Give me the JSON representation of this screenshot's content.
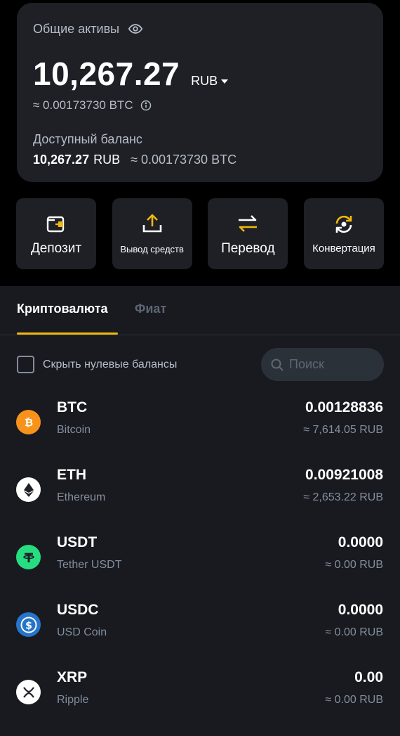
{
  "assets": {
    "title": "Общие активы",
    "total": "10,267.27",
    "currency": "RUB",
    "btc_equivalent": "≈ 0.00173730 BTC",
    "available_label": "Доступный баланс",
    "available_amount": "10,267.27",
    "available_currency": "RUB",
    "available_btc": "≈ 0.00173730 BTC"
  },
  "actions": [
    {
      "label": "Депозит",
      "icon": "deposit-wallet-icon"
    },
    {
      "label": "Вывод средств",
      "icon": "withdraw-upload-icon"
    },
    {
      "label": "Перевод",
      "icon": "transfer-arrows-icon"
    },
    {
      "label": "Конвертация",
      "icon": "convert-cycle-icon"
    }
  ],
  "tabs": {
    "crypto": "Криптовалюта",
    "fiat": "Фиат"
  },
  "filter": {
    "hide_zero_label": "Скрыть нулевые балансы",
    "search_placeholder": "Поиск"
  },
  "coins": [
    {
      "symbol": "BTC",
      "name": "Bitcoin",
      "amount": "0.00128836",
      "fiat": "≈ 7,614.05 RUB",
      "color": "#f7931a",
      "icon": "bitcoin-icon"
    },
    {
      "symbol": "ETH",
      "name": "Ethereum",
      "amount": "0.00921008",
      "fiat": "≈ 2,653.22 RUB",
      "color": "#ffffff",
      "icon": "ethereum-icon"
    },
    {
      "symbol": "USDT",
      "name": "Tether USDT",
      "amount": "0.0000",
      "fiat": "≈ 0.00 RUB",
      "color": "#26de81",
      "icon": "tether-icon"
    },
    {
      "symbol": "USDC",
      "name": "USD Coin",
      "amount": "0.0000",
      "fiat": "≈ 0.00 RUB",
      "color": "#2775ca",
      "icon": "usd-coin-icon"
    },
    {
      "symbol": "XRP",
      "name": "Ripple",
      "amount": "0.00",
      "fiat": "≈ 0.00 RUB",
      "color": "#ffffff",
      "icon": "ripple-icon"
    }
  ],
  "colors": {
    "accent": "#f0b90b",
    "card_bg": "#1e2026",
    "list_bg": "#181a20",
    "muted_text": "#848e9c"
  }
}
